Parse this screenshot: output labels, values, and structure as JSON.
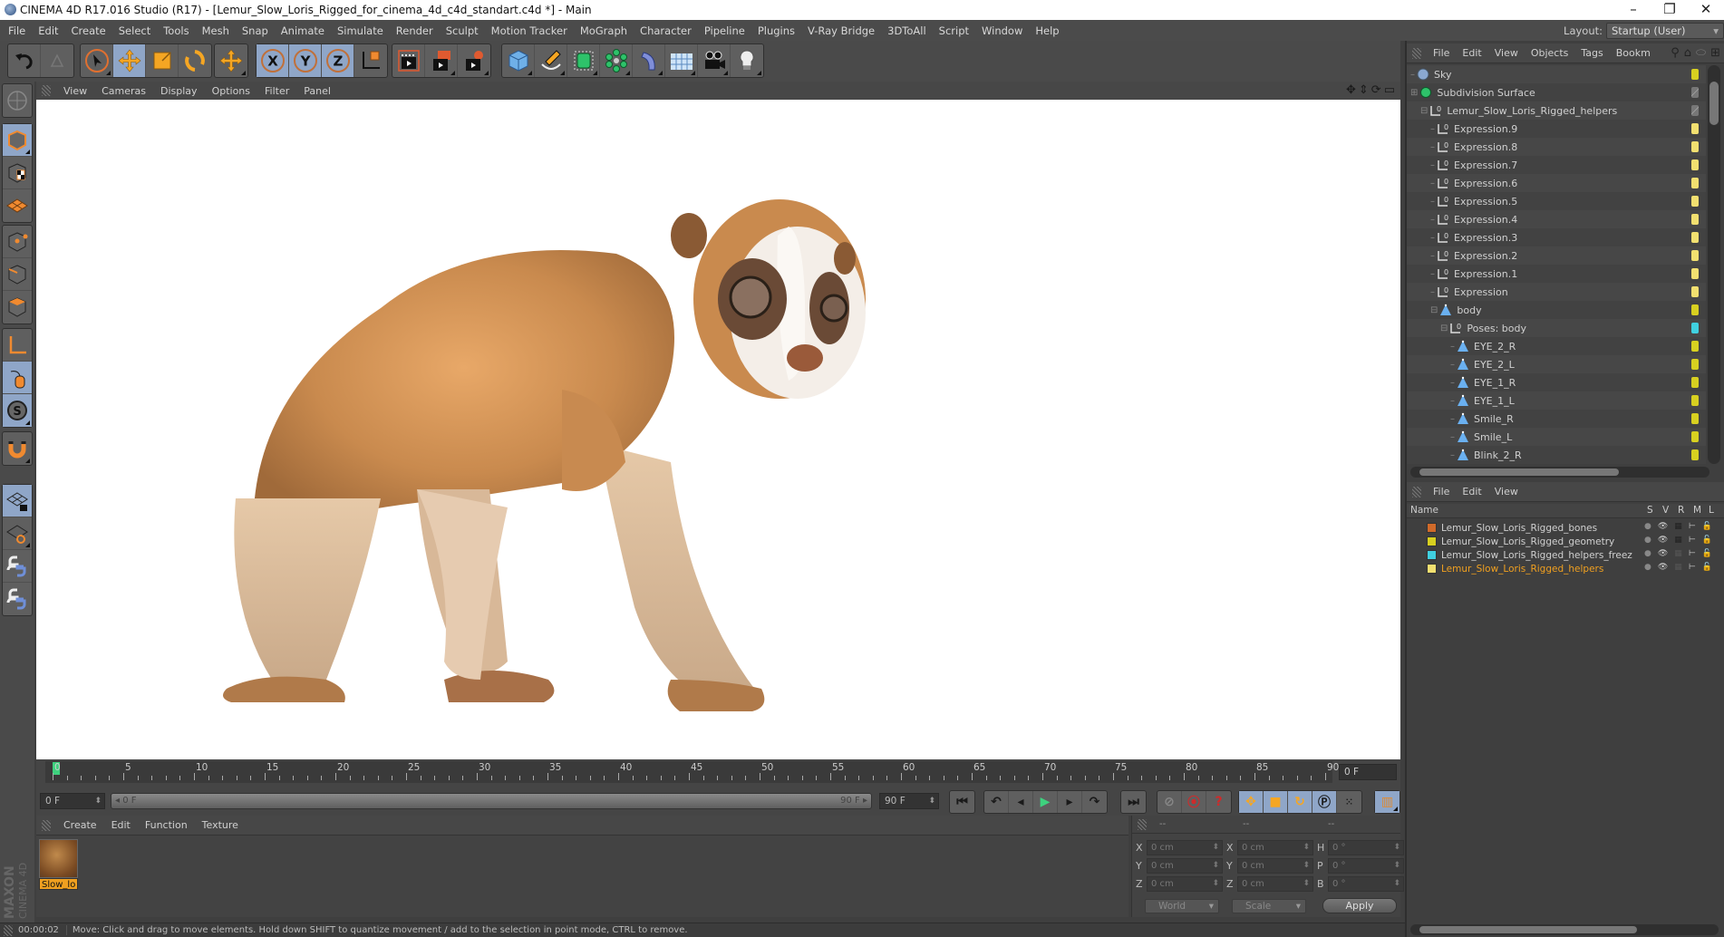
{
  "window": {
    "title": "CINEMA 4D R17.016 Studio (R17) - [Lemur_Slow_Loris_Rigged_for_cinema_4d_c4d_standart.c4d *] - Main",
    "minimize": "–",
    "restore": "❐",
    "close": "✕"
  },
  "menubar": {
    "items": [
      "File",
      "Edit",
      "Create",
      "Select",
      "Tools",
      "Mesh",
      "Snap",
      "Animate",
      "Simulate",
      "Render",
      "Sculpt",
      "Motion Tracker",
      "MoGraph",
      "Character",
      "Pipeline",
      "Plugins",
      "V-Ray Bridge",
      "3DToAll",
      "Script",
      "Window",
      "Help"
    ],
    "layout_label": "Layout:",
    "layout_value": "Startup (User)"
  },
  "toolbar": {
    "groups": [
      [
        "undo-icon",
        "redo-icon"
      ],
      [
        "select-tool-icon",
        "move-tool-icon",
        "scale-tool-icon",
        "rotate-tool-icon"
      ],
      [
        "recent-tool-icon"
      ],
      [
        "x-axis-icon",
        "y-axis-icon",
        "z-axis-icon",
        "coordinate-system-icon"
      ],
      [
        "render-view-icon",
        "render-picture-viewer-icon",
        "render-settings-icon"
      ],
      [
        "cube-icon",
        "pen-spline-icon",
        "subdivision-icon",
        "array-icon",
        "deformer-icon",
        "floor-icon",
        "camera-icon",
        "light-icon"
      ]
    ],
    "axis_labels": [
      "X",
      "Y",
      "Z"
    ]
  },
  "left_toolbar": {
    "items": [
      "make-editable-icon",
      "model-mode-icon",
      "texture-mode-icon",
      "workplane-mode-icon",
      "points-mode-icon",
      "edges-mode-icon",
      "polygons-mode-icon",
      "axis-mode-icon",
      "tweak-mode-icon",
      "snap-solo-icon",
      "magnet-icon",
      "lock-workplane-icon",
      "workplane-align-icon",
      "python-icon",
      "python-icon"
    ]
  },
  "viewport": {
    "menu": [
      "View",
      "Cameras",
      "Display",
      "Options",
      "Filter",
      "Panel"
    ],
    "nav_icons": [
      "move-view-icon",
      "zoom-view-icon",
      "rotate-view-icon",
      "toggle-view-icon"
    ],
    "subject": "Rigged slow loris 3D model"
  },
  "timeline": {
    "start": 0,
    "end": 90,
    "labels": [
      "0",
      "5",
      "10",
      "15",
      "20",
      "25",
      "30",
      "35",
      "40",
      "45",
      "50",
      "55",
      "60",
      "65",
      "70",
      "75",
      "80",
      "85",
      "90"
    ],
    "current_frame": "0 F",
    "range_start": "0 F",
    "range_bar_start": "0 F",
    "range_bar_end": "90 F",
    "range_end": "90 F"
  },
  "playback": {
    "buttons": [
      "go-to-start",
      "go-to-previous-key",
      "play-reverse",
      "play-forward",
      "go-to-next-key",
      "go-to-end"
    ],
    "record_buttons": [
      "motion-record",
      "record-active",
      "autokeying"
    ],
    "key_buttons": [
      "key-position",
      "key-scale",
      "key-rotation",
      "key-parameter",
      "key-point-level"
    ],
    "timeline_button": "timeline-window"
  },
  "material_manager": {
    "menu": [
      "Create",
      "Edit",
      "Function",
      "Texture"
    ],
    "materials": [
      {
        "name": "Slow_lo"
      }
    ]
  },
  "coordinates": {
    "headers": [
      "--",
      "--",
      "--"
    ],
    "rows": [
      {
        "a1": "X",
        "v1": "0 cm",
        "a2": "X",
        "v2": "0 cm",
        "a3": "H",
        "v3": "0 °"
      },
      {
        "a1": "Y",
        "v1": "0 cm",
        "a2": "Y",
        "v2": "0 cm",
        "a3": "P",
        "v3": "0 °"
      },
      {
        "a1": "Z",
        "v1": "0 cm",
        "a2": "Z",
        "v2": "0 cm",
        "a3": "B",
        "v3": "0 °"
      }
    ],
    "space": "World",
    "mode": "Scale",
    "apply": "Apply"
  },
  "brand": {
    "maxon": "MAXON",
    "product": "CINEMA 4D"
  },
  "status": {
    "time": "00:00:02",
    "message": "Move: Click and drag to move elements. Hold down SHIFT to quantize movement / add to the selection in point mode, CTRL to remove."
  },
  "object_manager": {
    "menu": [
      "File",
      "Edit",
      "View",
      "Objects",
      "Tags",
      "Bookm"
    ],
    "objects": [
      {
        "name": "Sky",
        "depth": 0,
        "icon": "sky",
        "layer": "#d8d020",
        "expand": ""
      },
      {
        "name": "Subdivision Surface",
        "depth": 0,
        "icon": "subdiv",
        "layer": "gray",
        "expand": "+"
      },
      {
        "name": "Lemur_Slow_Loris_Rigged_helpers",
        "depth": 1,
        "icon": "null",
        "layer": "gray",
        "expand": "−"
      },
      {
        "name": "Expression.9",
        "depth": 2,
        "icon": "null",
        "layer": "#f2e070",
        "expand": ""
      },
      {
        "name": "Expression.8",
        "depth": 2,
        "icon": "null",
        "layer": "#f2e070",
        "expand": ""
      },
      {
        "name": "Expression.7",
        "depth": 2,
        "icon": "null",
        "layer": "#f2e070",
        "expand": ""
      },
      {
        "name": "Expression.6",
        "depth": 2,
        "icon": "null",
        "layer": "#f2e070",
        "expand": ""
      },
      {
        "name": "Expression.5",
        "depth": 2,
        "icon": "null",
        "layer": "#f2e070",
        "expand": ""
      },
      {
        "name": "Expression.4",
        "depth": 2,
        "icon": "null",
        "layer": "#f2e070",
        "expand": ""
      },
      {
        "name": "Expression.3",
        "depth": 2,
        "icon": "null",
        "layer": "#f2e070",
        "expand": ""
      },
      {
        "name": "Expression.2",
        "depth": 2,
        "icon": "null",
        "layer": "#f2e070",
        "expand": ""
      },
      {
        "name": "Expression.1",
        "depth": 2,
        "icon": "null",
        "layer": "#f2e070",
        "expand": ""
      },
      {
        "name": "Expression",
        "depth": 2,
        "icon": "null",
        "layer": "#f2e070",
        "expand": ""
      },
      {
        "name": "body",
        "depth": 2,
        "icon": "joint",
        "layer": "#d8d020",
        "expand": "−"
      },
      {
        "name": "Poses: body",
        "depth": 3,
        "icon": "null",
        "layer": "#40d0e0",
        "expand": "−"
      },
      {
        "name": "EYE_2_R",
        "depth": 4,
        "icon": "joint",
        "layer": "#d8d020",
        "expand": ""
      },
      {
        "name": "EYE_2_L",
        "depth": 4,
        "icon": "joint",
        "layer": "#d8d020",
        "expand": ""
      },
      {
        "name": "EYE_1_R",
        "depth": 4,
        "icon": "joint",
        "layer": "#d8d020",
        "expand": ""
      },
      {
        "name": "EYE_1_L",
        "depth": 4,
        "icon": "joint",
        "layer": "#d8d020",
        "expand": ""
      },
      {
        "name": "Smile_R",
        "depth": 4,
        "icon": "joint",
        "layer": "#d8d020",
        "expand": ""
      },
      {
        "name": "Smile_L",
        "depth": 4,
        "icon": "joint",
        "layer": "#d8d020",
        "expand": ""
      },
      {
        "name": "Blink_2_R",
        "depth": 4,
        "icon": "joint",
        "layer": "#d8d020",
        "expand": ""
      }
    ]
  },
  "layer_manager": {
    "menu": [
      "File",
      "Edit",
      "View"
    ],
    "columns": {
      "name": "Name",
      "s": "S",
      "v": "V",
      "r": "R",
      "m": "M",
      "l": "L"
    },
    "layers": [
      {
        "name": "Lemur_Slow_Loris_Rigged_bones",
        "color": "#d06a2a",
        "active": false
      },
      {
        "name": "Lemur_Slow_Loris_Rigged_geometry",
        "color": "#d8d020",
        "active": false
      },
      {
        "name": "Lemur_Slow_Loris_Rigged_helpers_freez",
        "color": "#40d0e0",
        "active": false
      },
      {
        "name": "Lemur_Slow_Loris_Rigged_helpers",
        "color": "#f2e070",
        "active": true
      }
    ],
    "active_text_color": "#f0a020"
  }
}
